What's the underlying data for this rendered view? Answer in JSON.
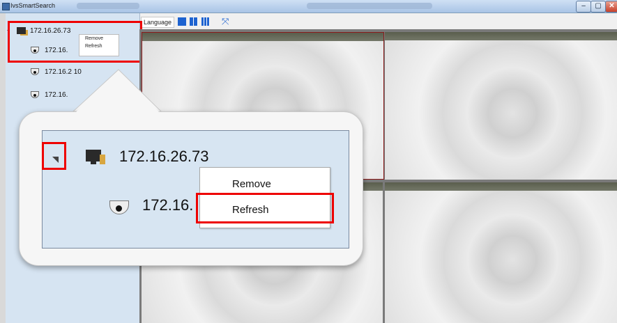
{
  "window": {
    "title": "IvsSmartSearch",
    "minimize": "–",
    "maximize": "▢",
    "close": "✕"
  },
  "toolbar": {
    "language": "Language"
  },
  "tree": {
    "root": "172.16.26.73",
    "children": [
      "172.16.",
      "172.16.2 10",
      "172.16."
    ]
  },
  "context_menu": {
    "items": [
      "Remove",
      "Refresh"
    ]
  },
  "zoom": {
    "root": "172.16.26.73",
    "child": "172.16.",
    "menu": [
      "Remove",
      "Refresh"
    ]
  },
  "colors": {
    "highlight": "#e00000",
    "sidebar": "#d6e4f2",
    "tile_bar": "#5a5e4d"
  }
}
